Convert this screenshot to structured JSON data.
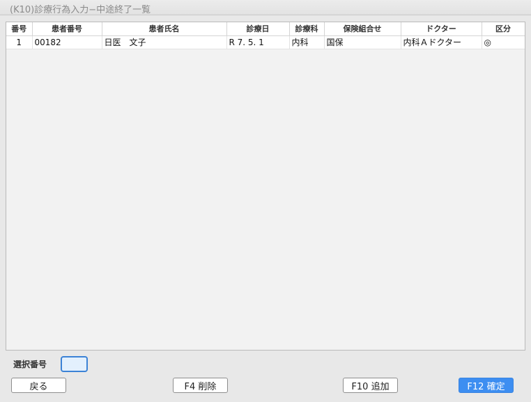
{
  "window": {
    "title": "(K10)診療行為入力−中途終了一覧"
  },
  "table": {
    "columns": [
      "番号",
      "患者番号",
      "患者氏名",
      "診療日",
      "診療科",
      "保険組合せ",
      "ドクター",
      "区分"
    ],
    "rows": [
      [
        "1",
        "00182",
        "日医　文子",
        "R 7. 5. 1",
        "内科",
        "国保",
        "内科Ａドクター",
        "◎"
      ]
    ]
  },
  "selection": {
    "label": "選択番号",
    "value": ""
  },
  "buttons": {
    "back": "戻る",
    "delete": "F4 削除",
    "add": "F10 追加",
    "confirm": "F12 確定"
  },
  "colors": {
    "confirm_button": "#3d8ef1",
    "input_border": "#3b82d6",
    "input_fill": "#e3f0fd"
  }
}
